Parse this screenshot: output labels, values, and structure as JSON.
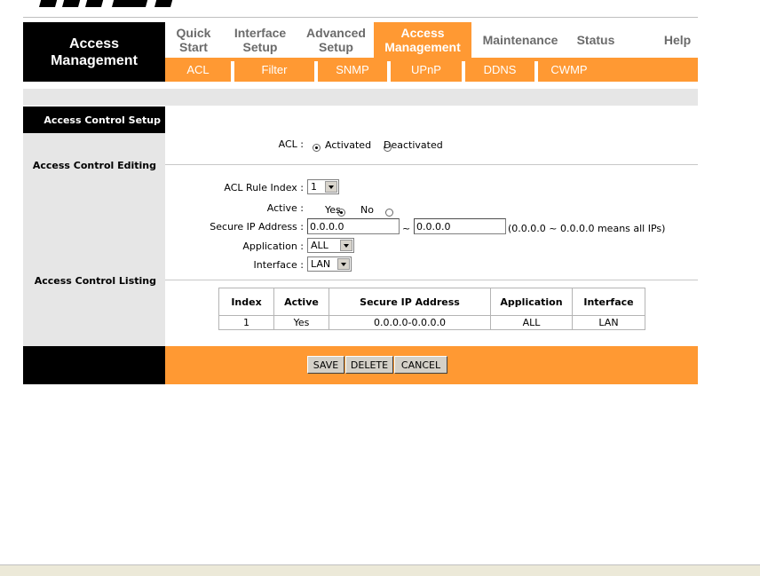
{
  "logo": {
    "text": "msi"
  },
  "header": {
    "page_title": "Access Management"
  },
  "nav": {
    "tabs": [
      {
        "label": "Quick Start"
      },
      {
        "label": "Interface Setup"
      },
      {
        "label": "Advanced Setup"
      },
      {
        "label": "Access Management",
        "active": true
      },
      {
        "label": "Maintenance"
      },
      {
        "label": "Status"
      },
      {
        "label": "Help"
      }
    ],
    "subtabs": [
      {
        "label": "ACL"
      },
      {
        "label": "Filter"
      },
      {
        "label": "SNMP"
      },
      {
        "label": "UPnP"
      },
      {
        "label": "DDNS"
      },
      {
        "label": "CWMP"
      }
    ]
  },
  "sidebar": {
    "section_title": "Access Control Setup",
    "editing": "Access Control Editing",
    "listing": "Access Control Listing"
  },
  "acl": {
    "label": "ACL :",
    "options": [
      {
        "label": "Activated",
        "checked": true
      },
      {
        "label": "Deactivated",
        "checked": false
      }
    ]
  },
  "form": {
    "rule_index": {
      "label": "ACL Rule Index :",
      "value": "1"
    },
    "active": {
      "label": "Active :",
      "options": [
        {
          "label": "Yes",
          "checked": true
        },
        {
          "label": "No",
          "checked": false
        }
      ]
    },
    "secure_ip": {
      "label": "Secure IP Address :",
      "start": "0.0.0.0",
      "separator": "~",
      "end": "0.0.0.0",
      "hint": "(0.0.0.0 ~ 0.0.0.0 means all IPs)"
    },
    "application": {
      "label": "Application :",
      "value": "ALL"
    },
    "interface": {
      "label": "Interface :",
      "value": "LAN"
    }
  },
  "table": {
    "columns": [
      "Index",
      "Active",
      "Secure IP Address",
      "Application",
      "Interface"
    ],
    "rows": [
      [
        "1",
        "Yes",
        "0.0.0.0-0.0.0.0",
        "ALL",
        "LAN"
      ]
    ]
  },
  "buttons": {
    "save": "SAVE",
    "delete": "DELETE",
    "cancel": "CANCEL"
  },
  "colors": {
    "accent": "#ff9933",
    "header_bg": "#000000",
    "panel_gray": "#e6e6e6",
    "tab_text": "#6b6b6b"
  }
}
